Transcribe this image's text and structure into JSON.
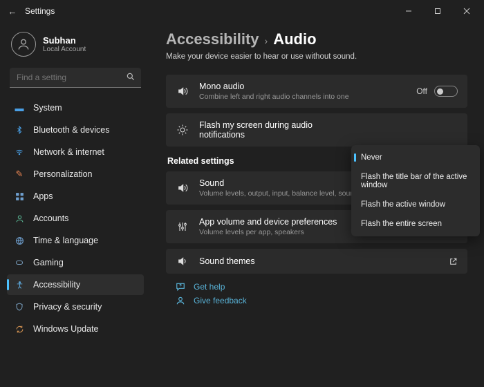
{
  "titlebar": {
    "title": "Settings"
  },
  "profile": {
    "name": "Subhan",
    "account": "Local Account"
  },
  "search": {
    "placeholder": "Find a setting"
  },
  "sidebar": {
    "items": [
      {
        "label": "System"
      },
      {
        "label": "Bluetooth & devices"
      },
      {
        "label": "Network & internet"
      },
      {
        "label": "Personalization"
      },
      {
        "label": "Apps"
      },
      {
        "label": "Accounts"
      },
      {
        "label": "Time & language"
      },
      {
        "label": "Gaming"
      },
      {
        "label": "Accessibility"
      },
      {
        "label": "Privacy & security"
      },
      {
        "label": "Windows Update"
      }
    ]
  },
  "breadcrumb": {
    "parent": "Accessibility",
    "page": "Audio"
  },
  "subtitle": "Make your device easier to hear or use without sound.",
  "cards": {
    "mono": {
      "title": "Mono audio",
      "desc": "Combine left and right audio channels into one",
      "state": "Off"
    },
    "flash": {
      "title": "Flash my screen during audio notifications",
      "selected": "Never"
    }
  },
  "related": {
    "heading": "Related settings",
    "sound": {
      "title": "Sound",
      "desc": "Volume levels, output, input, balance level, sound devices"
    },
    "appvol": {
      "title": "App volume and device preferences",
      "desc": "Volume levels per app, speakers"
    },
    "themes": {
      "title": "Sound themes"
    }
  },
  "dropdown": {
    "options": [
      "Never",
      "Flash the title bar of the active window",
      "Flash the active window",
      "Flash the entire screen"
    ]
  },
  "help": {
    "getHelp": "Get help",
    "feedback": "Give feedback"
  }
}
